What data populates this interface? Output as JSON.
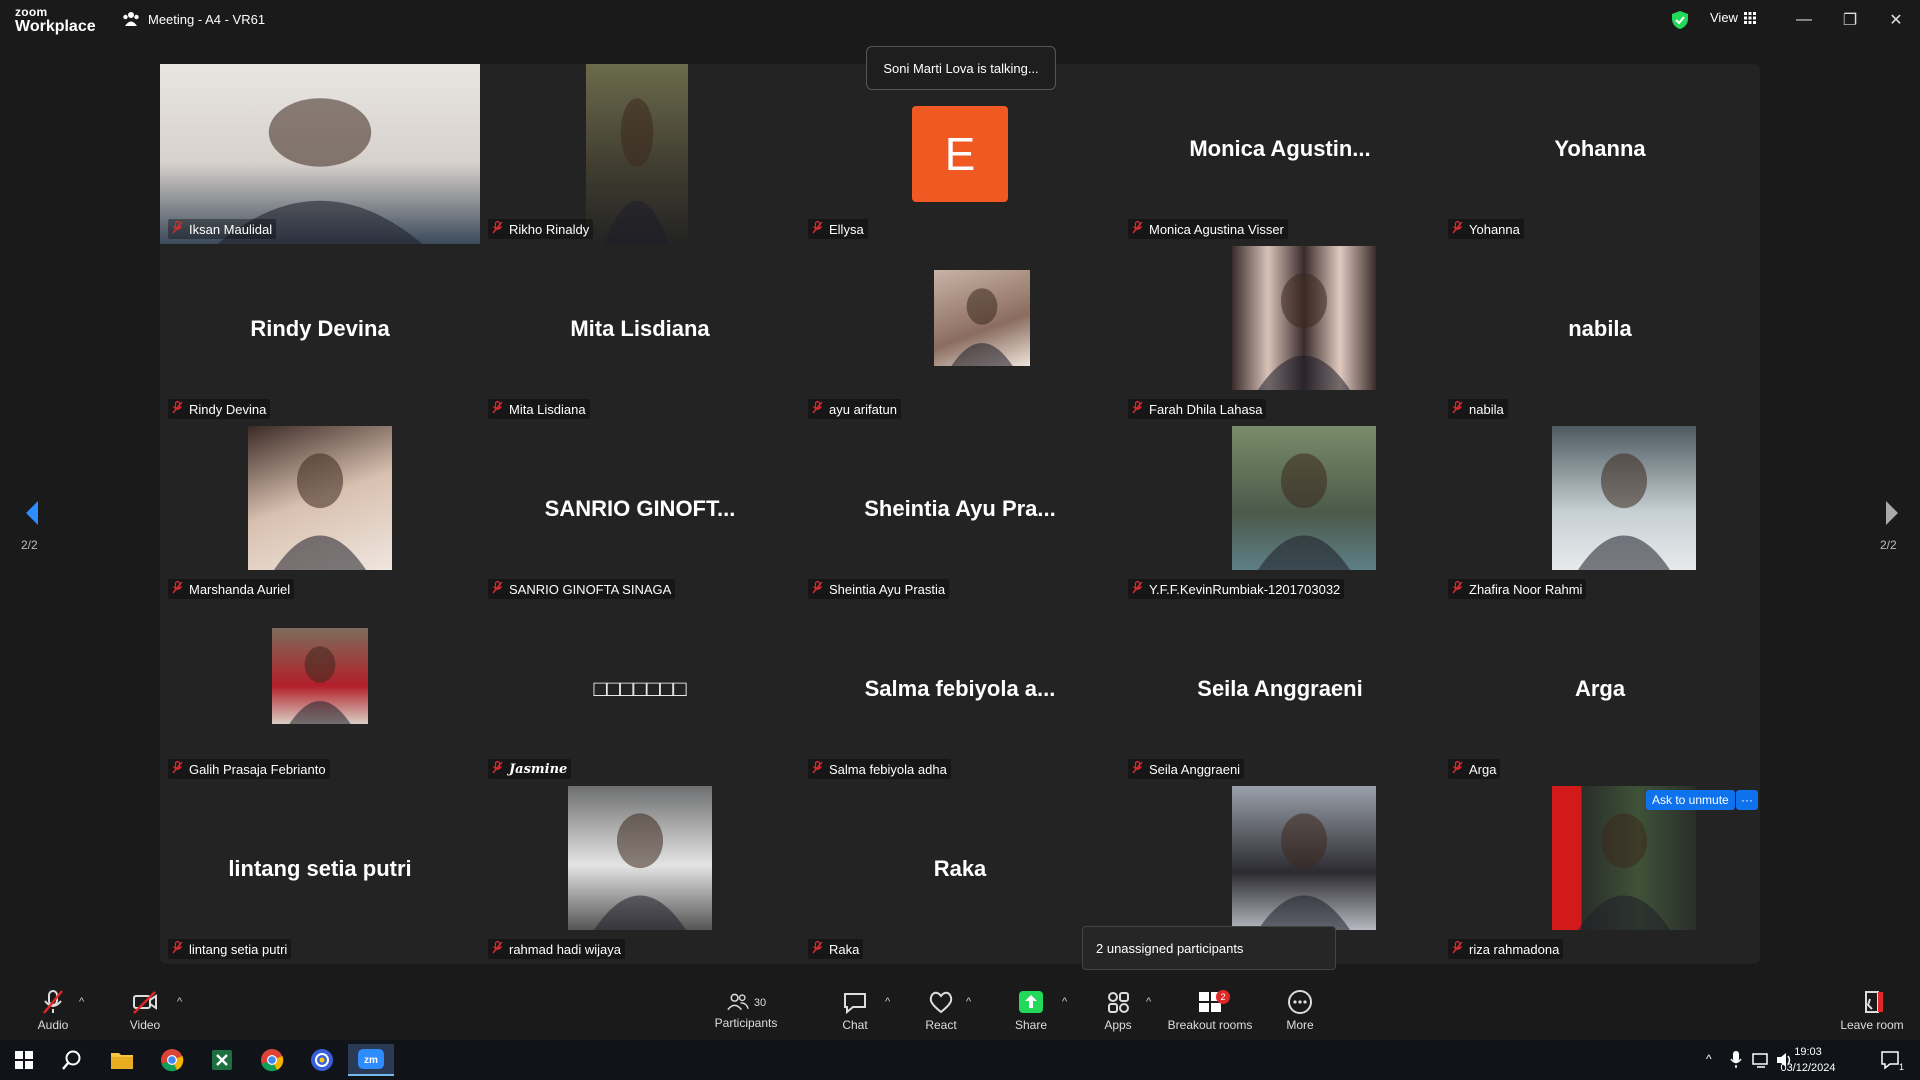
{
  "window": {
    "app_name_line1": "zoom",
    "app_name_line2": "Workplace",
    "meeting_title": "Meeting - A4 - VR61",
    "view_label": "View"
  },
  "talking_tooltip": "Soni Marti Lova is talking...",
  "unassigned_tooltip": "2 unassigned participants",
  "ask_to_unmute_label": "Ask to unmute",
  "more_dots_label": "···",
  "page_indicator_left": "2/2",
  "page_indicator_right": "2/2",
  "tiles": [
    {
      "display": "",
      "name": "Iksan Maulidal",
      "kind": "video"
    },
    {
      "display": "",
      "name": "Rikho Rinaldy",
      "kind": "video"
    },
    {
      "display": "E",
      "name": "Ellysa",
      "kind": "avatar"
    },
    {
      "display": "Monica  Agustin...",
      "name": "Monica Agustina Visser",
      "kind": "text"
    },
    {
      "display": "Yohanna",
      "name": "Yohanna",
      "kind": "text"
    },
    {
      "display": "Rindy Devina",
      "name": "Rindy Devina",
      "kind": "text"
    },
    {
      "display": "Mita Lisdiana",
      "name": "Mita Lisdiana",
      "kind": "text"
    },
    {
      "display": "",
      "name": "ayu arifatun",
      "kind": "photo"
    },
    {
      "display": "",
      "name": "Farah Dhila Lahasa",
      "kind": "photo"
    },
    {
      "display": "nabila",
      "name": "nabila",
      "kind": "text"
    },
    {
      "display": "",
      "name": "Marshanda Auriel",
      "kind": "photo"
    },
    {
      "display": "SANRIO  GINOFT...",
      "name": "SANRIO GINOFTA SINAGA",
      "kind": "text"
    },
    {
      "display": "Sheintia  Ayu  Pra...",
      "name": "Sheintia Ayu Prastia",
      "kind": "text"
    },
    {
      "display": "",
      "name": "Y.F.F.KevinRumbiak-1201703032",
      "kind": "photo"
    },
    {
      "display": "",
      "name": "Zhafira Noor Rahmi",
      "kind": "photo"
    },
    {
      "display": "",
      "name": "Galih Prasaja Febrianto",
      "kind": "photo"
    },
    {
      "display": "□□□□□□□",
      "name": "Jasmine",
      "kind": "text"
    },
    {
      "display": "Salma  febiyola  a...",
      "name": "Salma febiyola adha",
      "kind": "text"
    },
    {
      "display": "Seila Anggraeni",
      "name": "Seila Anggraeni",
      "kind": "text"
    },
    {
      "display": "Arga",
      "name": "Arga",
      "kind": "text"
    },
    {
      "display": "lintang setia putri",
      "name": "lintang setia putri",
      "kind": "text"
    },
    {
      "display": "",
      "name": "rahmad hadi wijaya",
      "kind": "photo"
    },
    {
      "display": "Raka",
      "name": "Raka",
      "kind": "text"
    },
    {
      "display": "",
      "name": "",
      "kind": "photo"
    },
    {
      "display": "",
      "name": "riza rahmadona",
      "kind": "photo"
    }
  ],
  "toolbar": {
    "audio": "Audio",
    "video": "Video",
    "participants": "Participants",
    "participants_count": "30",
    "chat": "Chat",
    "react": "React",
    "share": "Share",
    "apps": "Apps",
    "breakout": "Breakout rooms",
    "breakout_badge": "2",
    "more": "More",
    "leave": "Leave room"
  },
  "taskbar": {
    "time": "19:03",
    "date": "03/12/2024",
    "notif_count": "1"
  },
  "colors": {
    "accent_blue": "#0e72ed",
    "avatar_orange": "#f05a22",
    "share_green": "#23d959",
    "mute_red": "#e02828"
  }
}
